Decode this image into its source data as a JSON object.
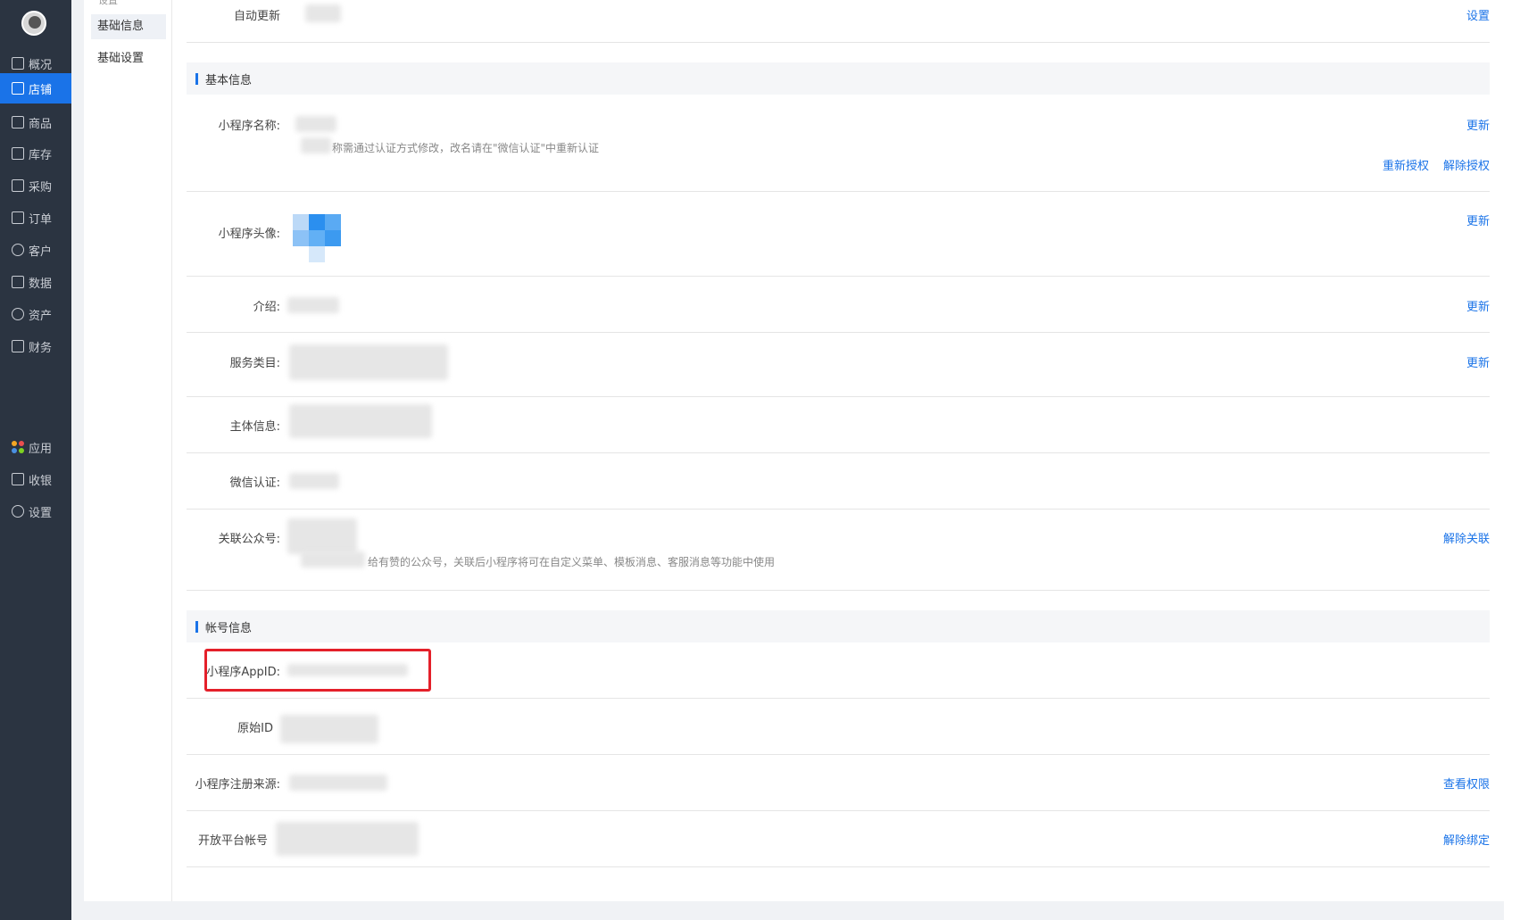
{
  "nav": {
    "items": [
      {
        "label": "概况",
        "icon": "monitor-icon"
      },
      {
        "label": "店铺",
        "icon": "store-icon",
        "active": true
      },
      {
        "label": "商品",
        "icon": "tag-icon"
      },
      {
        "label": "库存",
        "icon": "warehouse-icon"
      },
      {
        "label": "采购",
        "icon": "purchase-icon"
      },
      {
        "label": "订单",
        "icon": "order-icon"
      },
      {
        "label": "客户",
        "icon": "user-icon"
      },
      {
        "label": "数据",
        "icon": "chart-icon"
      },
      {
        "label": "资产",
        "icon": "yuan-icon"
      },
      {
        "label": "财务",
        "icon": "wallet-icon"
      }
    ],
    "bottom_items": [
      {
        "label": "应用",
        "icon": "apps-icon"
      },
      {
        "label": "收银",
        "icon": "cashier-icon"
      },
      {
        "label": "设置",
        "icon": "gear-icon"
      }
    ]
  },
  "subnav": {
    "cut_label": "设置",
    "items": [
      {
        "label": "基础信息",
        "active": true
      },
      {
        "label": "基础设置"
      }
    ]
  },
  "main": {
    "auto_update": {
      "label": "自动更新",
      "action": "设置"
    },
    "basic_section": "基本信息",
    "name": {
      "label": "小程序名称:",
      "hint": "称需通过认证方式修改，改名请在\"微信认证\"中重新认证",
      "action": "更新",
      "reauth": "重新授权",
      "unauth": "解除授权"
    },
    "avatar": {
      "label": "小程序头像:",
      "action": "更新"
    },
    "intro": {
      "label": "介绍:",
      "action": "更新"
    },
    "category": {
      "label": "服务类目:",
      "action": "更新"
    },
    "subject": {
      "label": "主体信息:"
    },
    "wechat_cert": {
      "label": "微信认证:"
    },
    "linked_account": {
      "label": "关联公众号:",
      "hint": "给有赞的公众号，关联后小程序将可在自定义菜单、模板消息、客服消息等功能中使用",
      "action": "解除关联"
    },
    "account_section": "帐号信息",
    "appid": {
      "label": "小程序AppID:"
    },
    "origin_id": {
      "label": "原始ID"
    },
    "reg_source": {
      "label": "小程序注册来源:",
      "action": "查看权限"
    },
    "open_platform": {
      "label": "开放平台帐号",
      "action": "解除绑定"
    }
  },
  "colors": {
    "accent": "#1a73e8",
    "nav_bg": "#2b3441",
    "highlight": "#e4202a"
  }
}
